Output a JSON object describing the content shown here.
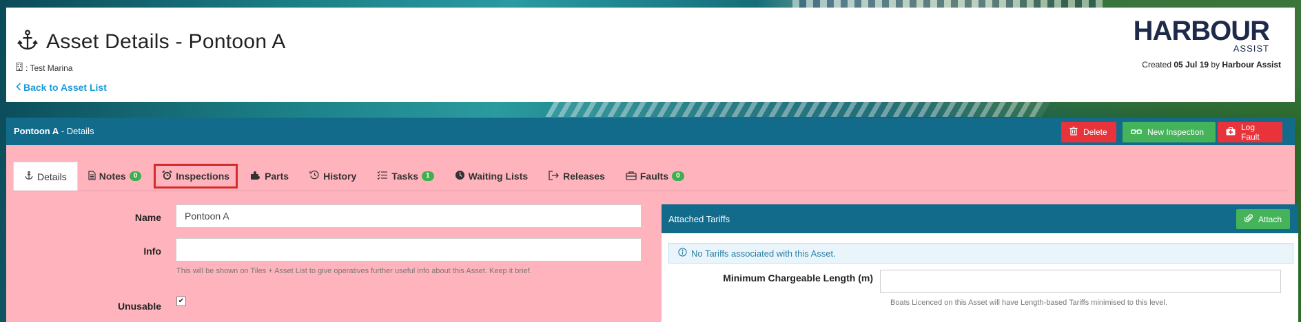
{
  "header": {
    "title": "Asset Details - Pontoon A",
    "marina_label": ": Test Marina",
    "back_link": "Back to Asset List",
    "logo_main": "HARBOUR",
    "logo_sub": "ASSIST",
    "created_prefix": "Created",
    "created_date": "05 Jul 19",
    "created_by_word": "by",
    "created_by": "Harbour Assist"
  },
  "panel": {
    "title_bold": "Pontoon A",
    "title_rest": " - Details",
    "buttons": {
      "delete": "Delete",
      "new_inspection": "New Inspection",
      "log_fault": "Log Fault"
    }
  },
  "tabs": [
    {
      "label": "Details",
      "icon": "anchor-icon",
      "active": true
    },
    {
      "label": "Notes",
      "icon": "document-icon",
      "badge": "0"
    },
    {
      "label": "Inspections",
      "icon": "alarm-clock-icon",
      "highlighted": true
    },
    {
      "label": "Parts",
      "icon": "puzzle-icon"
    },
    {
      "label": "History",
      "icon": "history-icon"
    },
    {
      "label": "Tasks",
      "icon": "tasks-icon",
      "badge": "1"
    },
    {
      "label": "Waiting Lists",
      "icon": "clock-icon"
    },
    {
      "label": "Releases",
      "icon": "sign-out-icon"
    },
    {
      "label": "Faults",
      "icon": "toolbox-icon",
      "badge": "0"
    }
  ],
  "form": {
    "name_label": "Name",
    "name_value": "Pontoon A",
    "info_label": "Info",
    "info_value": "",
    "info_help": "This will be shown on Tiles + Asset List to give operatives further useful info about this Asset. Keep it brief.",
    "unusable_label": "Unusable",
    "unusable_checked": true
  },
  "tariffs": {
    "title": "Attached Tariffs",
    "attach_label": "Attach",
    "no_tariffs_msg": "No Tariffs associated with this Asset.",
    "min_length_label": "Minimum Chargeable Length (m)",
    "min_length_value": "",
    "min_length_help": "Boats Licenced on this Asset will have Length-based Tariffs minimised to this level."
  },
  "colors": {
    "panel_blue": "#136b8c",
    "danger_red": "#e8333a",
    "success_green": "#45b35a",
    "panel_bg_pink": "#ffb3bd",
    "link_blue": "#1b9ad6",
    "highlight_outline": "#d42b2b"
  }
}
